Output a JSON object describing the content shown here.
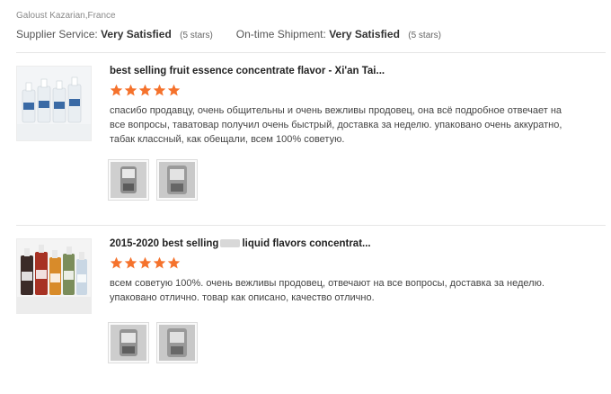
{
  "reviewer": "Galoust Kazarian,France",
  "ratings": {
    "supplier_label": "Supplier Service:",
    "supplier_value": "Very Satisfied",
    "supplier_stars": "(5 stars)",
    "shipment_label": "On-time Shipment:",
    "shipment_value": "Very Satisfied",
    "shipment_stars": "(5 stars)"
  },
  "reviews": [
    {
      "title": "best selling fruit essence concentrate flavor - Xi'an Tai...",
      "title_part1": "",
      "title_part2": "",
      "stars": 5,
      "text": "спасибо продавцу, очень общительны и очень вежливы продовец, она всё подробное отвечает на все вопросы, таватовар получил очень быстрый, доставка за неделю. упаковано очень аккуратно, табак классный, как обещали, всем 100% советую."
    },
    {
      "title": "",
      "title_part1": "2015-2020 best selling",
      "title_part2": "liquid flavors concentrat...",
      "stars": 5,
      "text": "всем советую 100%. очень вежливы продовец, отвечают на все вопросы, доставка за неделю. упаковано отлично. товар как описано, качество отлично."
    }
  ],
  "colors": {
    "star": "#f5722c",
    "divider": "#e6e6e6"
  },
  "icons": {
    "star": "star-icon"
  }
}
